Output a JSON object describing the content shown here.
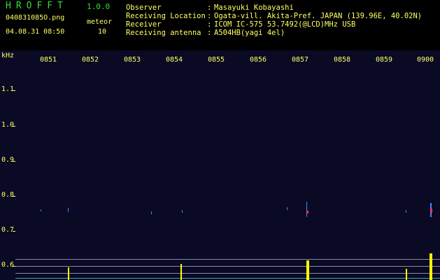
{
  "app": {
    "title": "HROFFT",
    "version": "1.0.0"
  },
  "file": {
    "name": "040831085O.png",
    "datetime": "04.08.31 08:50"
  },
  "meteor": {
    "label": "meteor",
    "count": "10"
  },
  "info": {
    "observer": {
      "label": "Observer",
      "value": "Masayuki Kobayashi"
    },
    "location": {
      "label": "Receiving Location",
      "value": "Ogata-vill. Akita-Pref. JAPAN (139.96E, 40.02N)"
    },
    "receiver": {
      "label": "Receiver",
      "value": "ICOM IC-575 53.7492(@LCD)MHz USB"
    },
    "antenna": {
      "label": "Receiving antenna",
      "value": "A504HB(yagi 4el)"
    },
    "separator": ":"
  },
  "plot": {
    "unit": "kHz",
    "y_labels": [
      "1.1",
      "1.0",
      "0.9",
      "0.8",
      "0.7",
      "0.6"
    ],
    "x_labels": [
      "0851",
      "0852",
      "0853",
      "0854",
      "0855",
      "0856",
      "0857",
      "0858",
      "0859",
      "0900"
    ]
  },
  "colors": {
    "text": "#ffff66",
    "title": "#33dd33",
    "background": "#0a0a24",
    "signal": "#4488ff",
    "meteor": "#ff3366",
    "spike": "#ffff00"
  }
}
